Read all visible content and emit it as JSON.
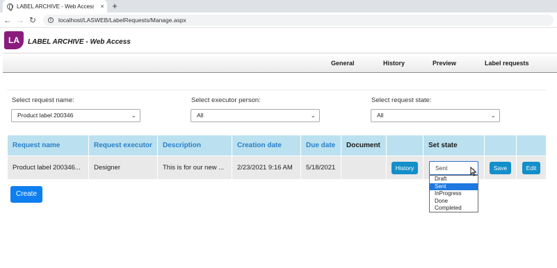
{
  "browser": {
    "tab_title": "LABEL ARCHIVE - Web Access",
    "tab_close": "×",
    "new_tab": "+",
    "back": "←",
    "forward": "→",
    "reload": "↻",
    "info_icon": "i",
    "url": "localhost/LASWEB/LabelRequests/Manage.aspx"
  },
  "app": {
    "logo_text": "LA",
    "title": "LABEL ARCHIVE - Web Access",
    "brand_color": "#8a1c7c"
  },
  "nav": {
    "items": [
      "General",
      "History",
      "Preview",
      "Label requests"
    ]
  },
  "filters": {
    "request_name": {
      "label": "Select request name:",
      "value": "Product label 200346"
    },
    "executor": {
      "label": "Select executor person:",
      "value": "All"
    },
    "state": {
      "label": "Select request state:",
      "value": "All"
    },
    "chevron": "⌄"
  },
  "table": {
    "headers": [
      "Request name",
      "Request executor",
      "Description",
      "Creation date",
      "Due date",
      "Document",
      "",
      "Set state",
      "",
      ""
    ],
    "rows": [
      {
        "request_name": "Product label 200346...",
        "executor": "Designer",
        "description": "This is for our new ...",
        "creation_date": "2/23/2021 9:16 AM",
        "due_date": "5/18/2021",
        "document": "",
        "history_label": "History",
        "state_value": "Sent",
        "save_label": "Save",
        "edit_label": "Edit"
      }
    ]
  },
  "state_dropdown": {
    "options": [
      "Draft",
      "Sent",
      "InProgress",
      "Done",
      "Completed"
    ],
    "selected": "Sent"
  },
  "create_label": "Create",
  "colors": {
    "header_bg": "#bbe1f0",
    "header_text": "#2880c8",
    "button": "#138fc9",
    "create_button": "#0d7ff0",
    "selected_option": "#1e78e0"
  }
}
